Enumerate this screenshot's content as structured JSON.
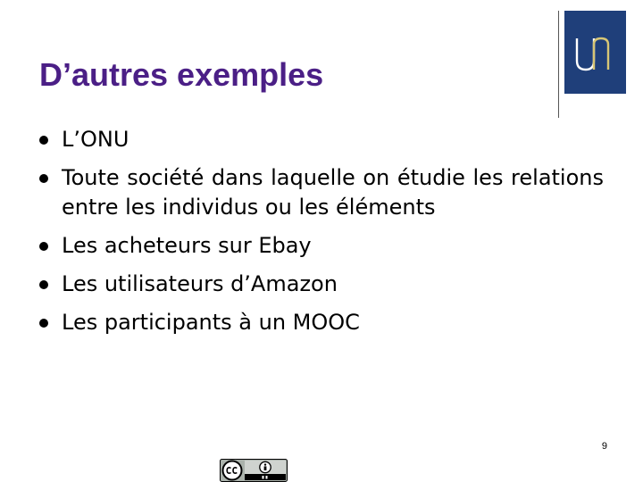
{
  "slide": {
    "title": "D’autres exemples",
    "bullets": [
      "L’ONU",
      "Toute société dans laquelle on étudie les relations entre les individus ou les éléments",
      "Les acheteurs sur Ebay",
      "Les utilisateurs d’Amazon",
      "Les participants à un MOOC"
    ],
    "page_number": "9"
  },
  "logo": {
    "icon": "university-logo-icon",
    "background_color": "#1f3f7a",
    "accent_color": "#d7c675"
  },
  "license_badge": {
    "icon": "creative-commons-by-icon"
  },
  "colors": {
    "title": "#4b1f86",
    "text": "#000000",
    "background": "#ffffff"
  }
}
